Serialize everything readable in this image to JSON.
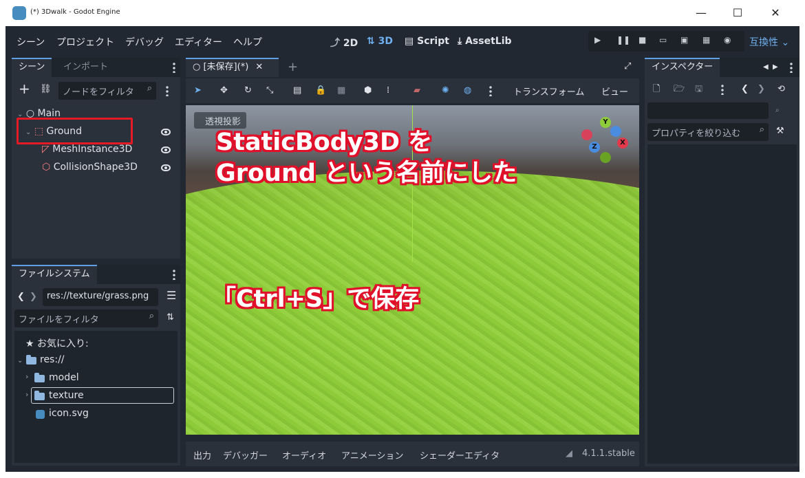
{
  "window": {
    "title": "(*) 3Dwalk - Godot Engine",
    "minimize": "—",
    "maximize": "☐",
    "close": "✕"
  },
  "menu": [
    "シーン",
    "プロジェクト",
    "デバッグ",
    "エディター",
    "ヘルプ"
  ],
  "workspace": {
    "2d": "2D",
    "3d": "3D",
    "script": "Script",
    "assetlib": "AssetLib"
  },
  "renderer": "互換性",
  "scene_dock": {
    "tabs": [
      "シーン",
      "インポート"
    ],
    "filter_placeholder": "ノードをフィルタ",
    "tree": {
      "root": "Main",
      "selected": "Ground",
      "children": [
        "MeshInstance3D",
        "CollisionShape3D"
      ]
    }
  },
  "filesystem_dock": {
    "tab": "ファイルシステム",
    "path": "res://texture/grass.png",
    "filter_placeholder": "ファイルをフィルタ",
    "favorites": "お気に入り:",
    "root": "res://",
    "items": [
      "model",
      "texture",
      "icon.svg"
    ]
  },
  "editor_tab": {
    "label": "[未保存](*)"
  },
  "viewport_toolbar": {
    "transform": "トランスフォーム",
    "view": "ビュー"
  },
  "viewport": {
    "perspective_label": "透視投影"
  },
  "gizmo": {
    "y": "Y",
    "z": "Z",
    "x": "X"
  },
  "annotations": {
    "line1": "StaticBody3D を",
    "line2": "Ground という名前にした",
    "line3": "「Ctrl+S」で保存"
  },
  "bottom_panel": {
    "tabs": [
      "出力",
      "デバッガー",
      "オーディオ",
      "アニメーション",
      "シェーダーエディタ"
    ],
    "version": "4.1.1.stable"
  },
  "inspector": {
    "tab": "インスペクター",
    "filter_placeholder": "プロパティを絞り込む"
  },
  "colors": {
    "accent": "#5fa0e6",
    "highlight": "#e51a24",
    "bg": "#222831",
    "panel": "#2a313b"
  }
}
